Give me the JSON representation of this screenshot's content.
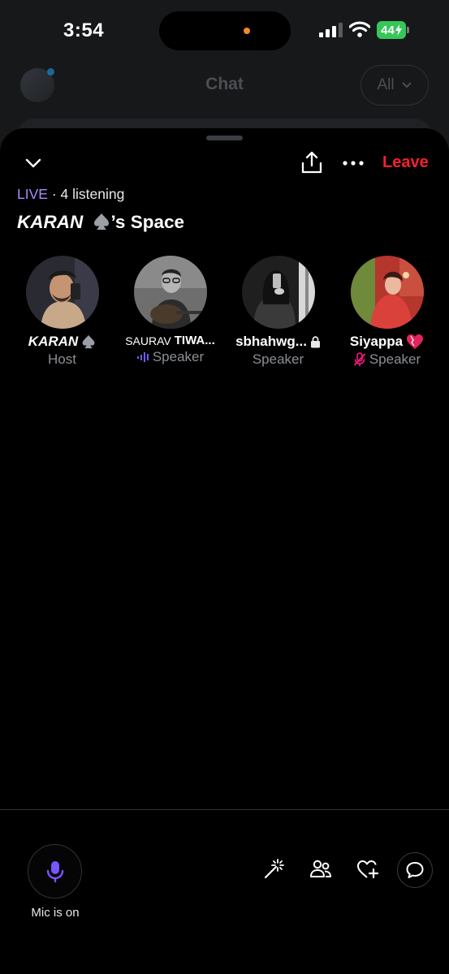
{
  "status_bar": {
    "time": "3:54",
    "battery": "44"
  },
  "background_app": {
    "title": "Chat",
    "filter_label": "All"
  },
  "space": {
    "leave_label": "Leave",
    "live_tag": "LIVE",
    "listeners": "· 4 listening",
    "host_name": "KARAN",
    "title_suffix": "’s Space",
    "participants": [
      {
        "name": "KARAN",
        "role": "Host",
        "role_color": "#8b8f94"
      },
      {
        "name_prefix": "SAURAV",
        "name_rest": "TIWA...",
        "role": "Speaker",
        "status": "speaking"
      },
      {
        "name": "sbhahwg...",
        "role": "Speaker",
        "status": "locked"
      },
      {
        "name": "Siyappa",
        "role": "Speaker",
        "status": "muted"
      }
    ]
  },
  "controls": {
    "mic_label": "Mic is on"
  },
  "colors": {
    "accent": "#a78bfa",
    "leave": "#f4212e",
    "muted": "#f91880",
    "mic": "#7856ff"
  }
}
